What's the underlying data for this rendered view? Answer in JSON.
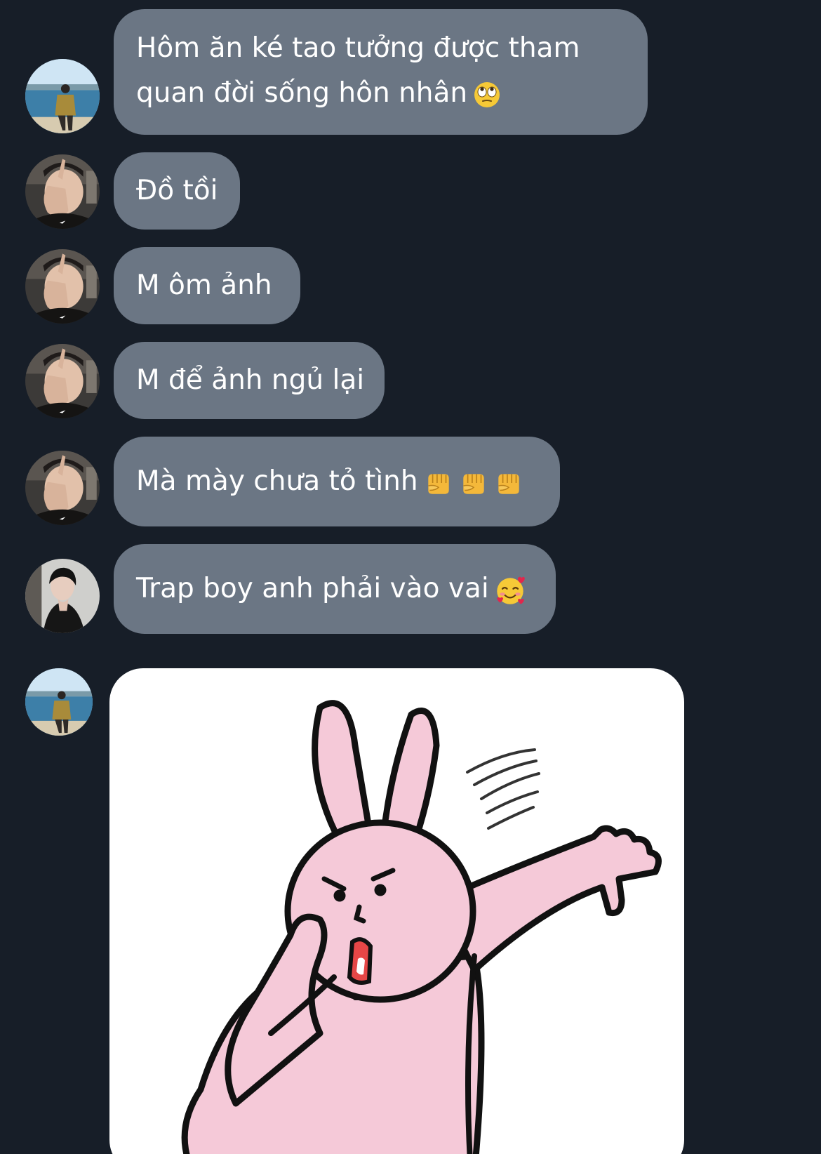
{
  "messages": [
    {
      "text_line1": "Hôm ăn ké tao tưởng được tham",
      "text_line2": "quan đời sống hôn nhân",
      "emoji": "face-with-rolling-eyes",
      "avatar": "avatar-beach"
    },
    {
      "text": "Đồ tồi",
      "avatar": "avatar-hand-face"
    },
    {
      "text": "M ôm ảnh",
      "avatar": "avatar-hand-face"
    },
    {
      "text": "M để ảnh ngủ lại",
      "avatar": "avatar-hand-face"
    },
    {
      "text": "Mà mày chưa tỏ tình",
      "emoji": [
        "oncoming-fist",
        "oncoming-fist",
        "oncoming-fist"
      ],
      "avatar": "avatar-hand-face"
    },
    {
      "text": "Trap boy anh phải vào vai",
      "emoji": "smiling-face-with-hearts",
      "avatar": "avatar-dark-portrait"
    },
    {
      "sticker": "pink-rabbit-thumbs-down",
      "avatar": "avatar-beach"
    }
  ],
  "colors": {
    "background": "#171e28",
    "bubble": "#6b7684",
    "text": "#ffffff",
    "sticker_bg": "#ffffff",
    "rabbit": "#f5c9d8"
  }
}
